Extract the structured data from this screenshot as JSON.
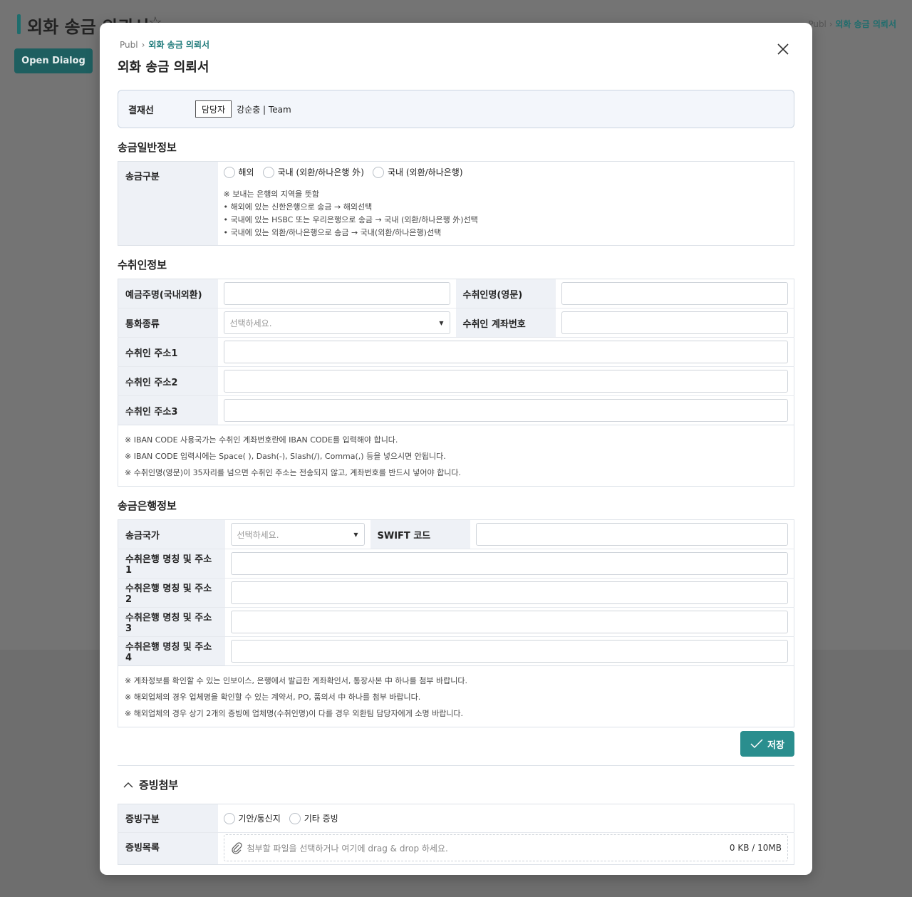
{
  "background": {
    "page_title": "외화 송금 의뢰서",
    "star": "☆",
    "breadcrumb": {
      "root": "Publ",
      "current": "외화 송금 의뢰서"
    },
    "open_dialog_label": "Open Dialog"
  },
  "dialog": {
    "breadcrumb": {
      "root": "Publ",
      "current": "외화 송금 의뢰서"
    },
    "title": "외화 송금 의뢰서",
    "approval": {
      "label": "결재선",
      "role": "담당자",
      "name": "강순충 | Team"
    },
    "general": {
      "title": "송금일반정보",
      "type_label": "송금구분",
      "options": [
        "해외",
        "국내 (외환/하나은행 外)",
        "국내 (외환/하나은행)"
      ],
      "notes": [
        "※ 보내는 은행의 지역을 뜻함",
        "• 해외에 있는 신한은행으로 송금 → 해외선택",
        "• 국내에 있는 HSBC 또는 우리은행으로 송금 → 국내 (외환/하나은행 外)선택",
        "• 국내에 있는 외환/하나은행으로 송금 → 국내(외환/하나은행)선택"
      ]
    },
    "recipient": {
      "title": "수취인정보",
      "depositor_label": "예금주명(국내외환)",
      "depositor_value": "",
      "name_en_label": "수취인명(영문)",
      "name_en_value": "",
      "currency_label": "통화종류",
      "currency_placeholder": "선택하세요.",
      "account_label": "수취인 계좌번호",
      "account_value": "",
      "address1_label": "수취인 주소1",
      "address2_label": "수취인 주소2",
      "address3_label": "수취인 주소3",
      "notes": [
        "※ IBAN CODE 사용국가는 수취인 계좌번호란에 IBAN CODE를 입력해야 합니다.",
        "※ IBAN CODE 입력시에는 Space( ), Dash(-), Slash(/), Comma(,) 등을 넣으시면 안됩니다.",
        "※ 수취인명(영문)이 35자리를 넘으면 수취인 주소는 전송되지 않고, 계좌번호를 반드시 넣어야 합니다."
      ]
    },
    "bank": {
      "title": "송금은행정보",
      "country_label": "송금국가",
      "country_placeholder": "선택하세요.",
      "swift_label": "SWIFT 코드",
      "bank1_label": "수취은행 명칭 및 주소1",
      "bank2_label": "수취은행 명칭 및 주소2",
      "bank3_label": "수취은행 명칭 및 주소3",
      "bank4_label": "수취은행 명칭 및 주소4",
      "notes": [
        "※ 계좌정보를 확인할 수 있는 인보이스, 은행에서 발급한 계좌확인서, 통장사본 中 하나를 첨부 바랍니다.",
        "※ 해외업체의 경우 업체명을 확인할 수 있는 계약서, PO, 품의서 中 하나를 첨부 바랍니다.",
        "※ 해외업체의 경우 상기 2개의 증빙에 업체명(수취인명)이 다를 경우 외환팀 담당자에게 소명 바랍니다."
      ]
    },
    "save_label": "저장",
    "attachments": {
      "title": "증빙첨부",
      "type_label": "증빙구분",
      "options": [
        "기안/통신지",
        "기타 증빙"
      ],
      "list_label": "증빙목록",
      "drop_hint": "첨부할 파일을 선택하거나 여기에 drag & drop 하세요.",
      "size_text": "0 KB / 10MB"
    }
  },
  "colors": {
    "accent": "#2a8e8e",
    "dark_accent": "#1e5f60",
    "header_bg": "#eef1f6"
  }
}
